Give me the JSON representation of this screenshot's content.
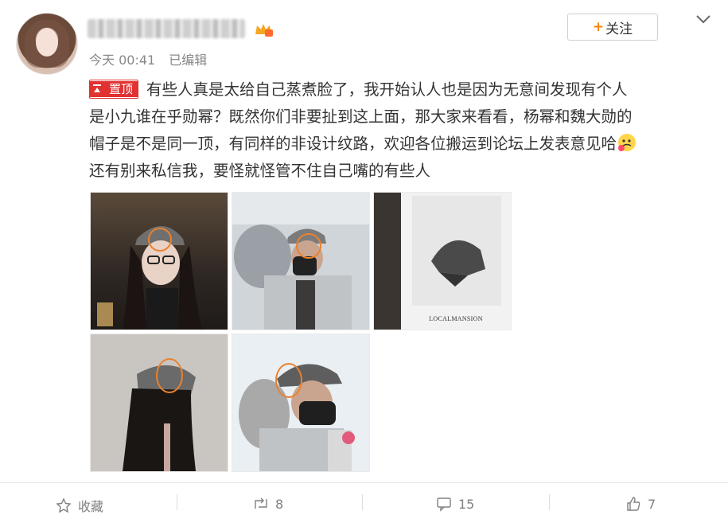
{
  "post": {
    "meta": {
      "time": "今天 00:41",
      "edited": "已编辑"
    },
    "follow_label": "关注",
    "pin_label": "置顶",
    "text_lines": [
      "有些人真是太给自己蒸煮脸了，我开始认人也是因为无意间发现有个人",
      "是小九谁在乎勋幂？既然你们非要扯到这上面，那大家来看看，杨幂和魏大勋的",
      "帽子是不是同一顶，有同样的非设计纹路，欢迎各位搬运到论坛上发表意见哈",
      "还有别来私信我，要怪就怪管不住自己嘴的有些人"
    ],
    "product_label": "LOCALMANSION"
  },
  "actions": {
    "favorite": "收藏",
    "repost": "8",
    "comment": "15",
    "like": "7"
  },
  "colors": {
    "accent": "#ff8200",
    "pin_red": "#e23131",
    "highlight_circle": "#e9822f"
  },
  "icons": [
    "crown-icon",
    "chevron-down-icon",
    "pin-icon",
    "emoji-icon",
    "favorite-icon",
    "repost-icon",
    "comment-icon",
    "like-icon"
  ]
}
